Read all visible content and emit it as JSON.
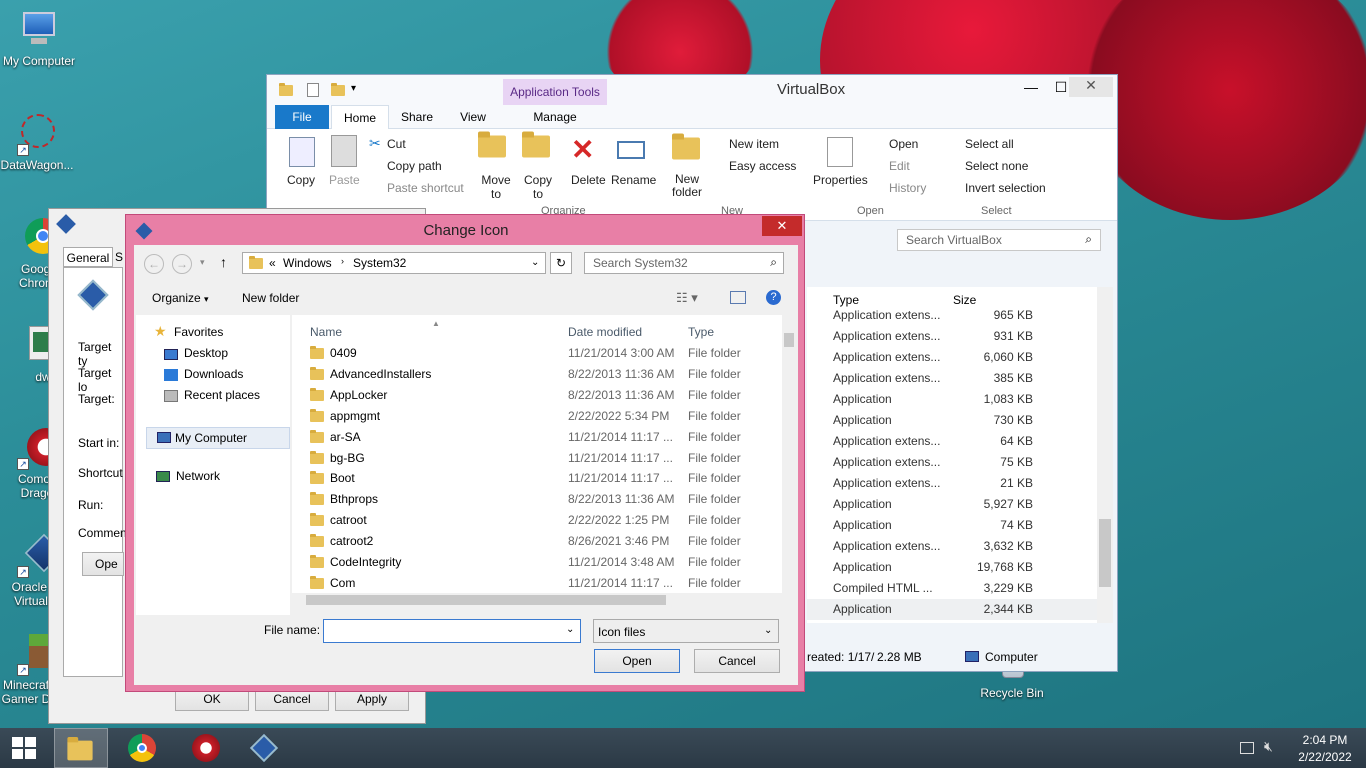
{
  "desktop_icons": [
    {
      "label": "My Computer"
    },
    {
      "label": "DataWagon..."
    },
    {
      "label": "Googl Chrom"
    },
    {
      "label": "dwm"
    },
    {
      "label": "Comod Drago"
    },
    {
      "label": "Oracle V VirtualB"
    },
    {
      "label": "Minecraf Gamer D"
    },
    {
      "label": "Recycle Bin"
    }
  ],
  "explorer": {
    "title": "VirtualBox",
    "context_tab": "Application Tools",
    "tabs": [
      "File",
      "Home",
      "Share",
      "View",
      "Manage"
    ],
    "ribbon": {
      "copy": "Copy",
      "paste": "Paste",
      "cut": "Cut",
      "copy_path": "Copy path",
      "paste_shortcut": "Paste shortcut",
      "move_to": "Move to",
      "copy_to": "Copy to",
      "delete": "Delete",
      "rename": "Rename",
      "new_folder": "New folder",
      "new_item": "New item",
      "easy_access": "Easy access",
      "properties": "Properties",
      "open": "Open",
      "edit": "Edit",
      "history": "History",
      "select_all": "Select all",
      "select_none": "Select none",
      "invert_selection": "Invert selection",
      "groups": {
        "organize": "Organize",
        "new": "New",
        "open": "Open",
        "select": "Select"
      }
    },
    "search_placeholder": "Search VirtualBox",
    "columns": {
      "type": "Type",
      "size": "Size"
    },
    "rows": [
      {
        "type": "Application extens...",
        "size": "965 KB"
      },
      {
        "type": "Application extens...",
        "size": "931 KB"
      },
      {
        "type": "Application extens...",
        "size": "6,060 KB"
      },
      {
        "type": "Application extens...",
        "size": "385 KB"
      },
      {
        "type": "Application",
        "size": "1,083 KB"
      },
      {
        "type": "Application",
        "size": "730 KB"
      },
      {
        "type": "Application extens...",
        "size": "64 KB"
      },
      {
        "type": "Application extens...",
        "size": "75 KB"
      },
      {
        "type": "Application extens...",
        "size": "21 KB"
      },
      {
        "type": "Application",
        "size": "5,927 KB"
      },
      {
        "type": "Application",
        "size": "74 KB"
      },
      {
        "type": "Application extens...",
        "size": "3,632 KB"
      },
      {
        "type": "Application",
        "size": "19,768 KB"
      },
      {
        "type": "Compiled HTML ...",
        "size": "3,229 KB"
      },
      {
        "type": "Application",
        "size": "2,344 KB"
      }
    ],
    "status_created": "reated: 1/17/",
    "status_size": "2.28 MB",
    "status_computer": "Computer"
  },
  "props": {
    "tabs": [
      "General",
      "S"
    ],
    "labels": [
      "Target ty",
      "Target lo",
      "Target:",
      "Start in:",
      "Shortcut",
      "Run:",
      "Commen"
    ],
    "open_btn": "Ope",
    "ok": "OK",
    "cancel": "Cancel",
    "apply": "Apply"
  },
  "dialog": {
    "title": "Change Icon",
    "path": [
      "«",
      "Windows",
      "System32"
    ],
    "search_placeholder": "Search System32",
    "organize": "Organize",
    "new_folder": "New folder",
    "nav": {
      "favorites": "Favorites",
      "desktop": "Desktop",
      "downloads": "Downloads",
      "recent": "Recent places",
      "computer": "My Computer",
      "network": "Network"
    },
    "columns": {
      "name": "Name",
      "date": "Date modified",
      "type": "Type"
    },
    "files": [
      {
        "name": "0409",
        "date": "11/21/2014 3:00 AM",
        "type": "File folder"
      },
      {
        "name": "AdvancedInstallers",
        "date": "8/22/2013 11:36 AM",
        "type": "File folder"
      },
      {
        "name": "AppLocker",
        "date": "8/22/2013 11:36 AM",
        "type": "File folder"
      },
      {
        "name": "appmgmt",
        "date": "2/22/2022 5:34 PM",
        "type": "File folder"
      },
      {
        "name": "ar-SA",
        "date": "11/21/2014 11:17 ...",
        "type": "File folder"
      },
      {
        "name": "bg-BG",
        "date": "11/21/2014 11:17 ...",
        "type": "File folder"
      },
      {
        "name": "Boot",
        "date": "11/21/2014 11:17 ...",
        "type": "File folder"
      },
      {
        "name": "Bthprops",
        "date": "8/22/2013 11:36 AM",
        "type": "File folder"
      },
      {
        "name": "catroot",
        "date": "2/22/2022 1:25 PM",
        "type": "File folder"
      },
      {
        "name": "catroot2",
        "date": "8/26/2021 3:46 PM",
        "type": "File folder"
      },
      {
        "name": "CodeIntegrity",
        "date": "11/21/2014 3:48 AM",
        "type": "File folder"
      },
      {
        "name": "Com",
        "date": "11/21/2014 11:17 ...",
        "type": "File folder"
      }
    ],
    "file_name_label": "File name:",
    "file_name_value": "",
    "filter": "Icon files",
    "open": "Open",
    "cancel": "Cancel"
  },
  "taskbar": {
    "time": "2:04 PM",
    "date": "2/22/2022"
  }
}
